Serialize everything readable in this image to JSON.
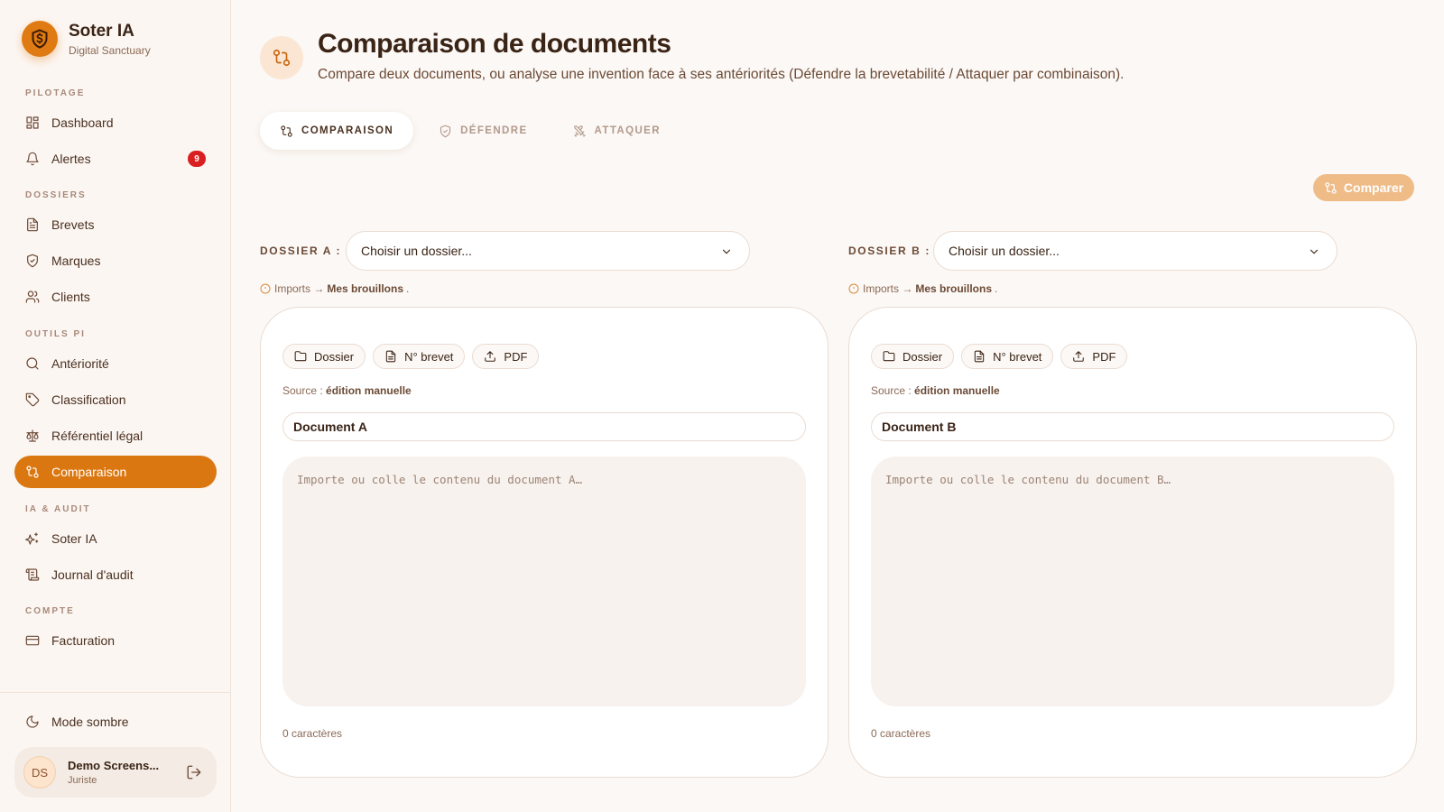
{
  "brand": {
    "name": "Soter IA",
    "tagline": "Digital Sanctuary"
  },
  "sidebar": {
    "sections": {
      "pilotage": "PILOTAGE",
      "dossiers": "DOSSIERS",
      "outils": "OUTILS PI",
      "ia": "IA & AUDIT",
      "compte": "COMPTE"
    },
    "items": {
      "dashboard": "Dashboard",
      "alertes": "Alertes",
      "alertes_count": "9",
      "brevets": "Brevets",
      "marques": "Marques",
      "clients": "Clients",
      "anteriorite": "Antériorité",
      "classification": "Classification",
      "referentiel": "Référentiel légal",
      "comparaison": "Comparaison",
      "soter_ia": "Soter IA",
      "journal": "Journal d'audit",
      "facturation": "Facturation"
    },
    "dark_mode": "Mode sombre",
    "user": {
      "initials": "DS",
      "name": "Demo Screens...",
      "role": "Juriste"
    }
  },
  "header": {
    "title": "Comparaison de documents",
    "subtitle": "Compare deux documents, ou analyse une invention face à ses antériorités (Défendre la brevetabilité / Attaquer par combinaison)."
  },
  "tabs": [
    {
      "label": "COMPARAISON",
      "icon": "compare-icon",
      "active": true
    },
    {
      "label": "DÉFENDRE",
      "icon": "shield-icon",
      "active": false
    },
    {
      "label": "ATTAQUER",
      "icon": "swords-icon",
      "active": false
    }
  ],
  "compare_button": "Comparer",
  "panels": {
    "a": {
      "dossier_label": "DOSSIER A :",
      "select_value": "Choisir un dossier...",
      "hint_prefix": "Imports →",
      "hint_link": "Mes brouillons",
      "hint_suffix": ".",
      "chips": [
        "Dossier",
        "N° brevet",
        "PDF"
      ],
      "source_label": "Source :",
      "source_value": "édition manuelle",
      "doc_title": "Document A",
      "placeholder": "Importe ou colle le contenu du document A…",
      "char_count": "0 caractères"
    },
    "b": {
      "dossier_label": "DOSSIER B :",
      "select_value": "Choisir un dossier...",
      "hint_prefix": "Imports →",
      "hint_link": "Mes brouillons",
      "hint_suffix": ".",
      "chips": [
        "Dossier",
        "N° brevet",
        "PDF"
      ],
      "source_label": "Source :",
      "source_value": "édition manuelle",
      "doc_title": "Document B",
      "placeholder": "Importe ou colle le contenu du document B…",
      "char_count": "0 caractères"
    }
  },
  "colors": {
    "accent": "#db7710",
    "badge": "#d91f1f",
    "background": "#fcf8f5"
  }
}
